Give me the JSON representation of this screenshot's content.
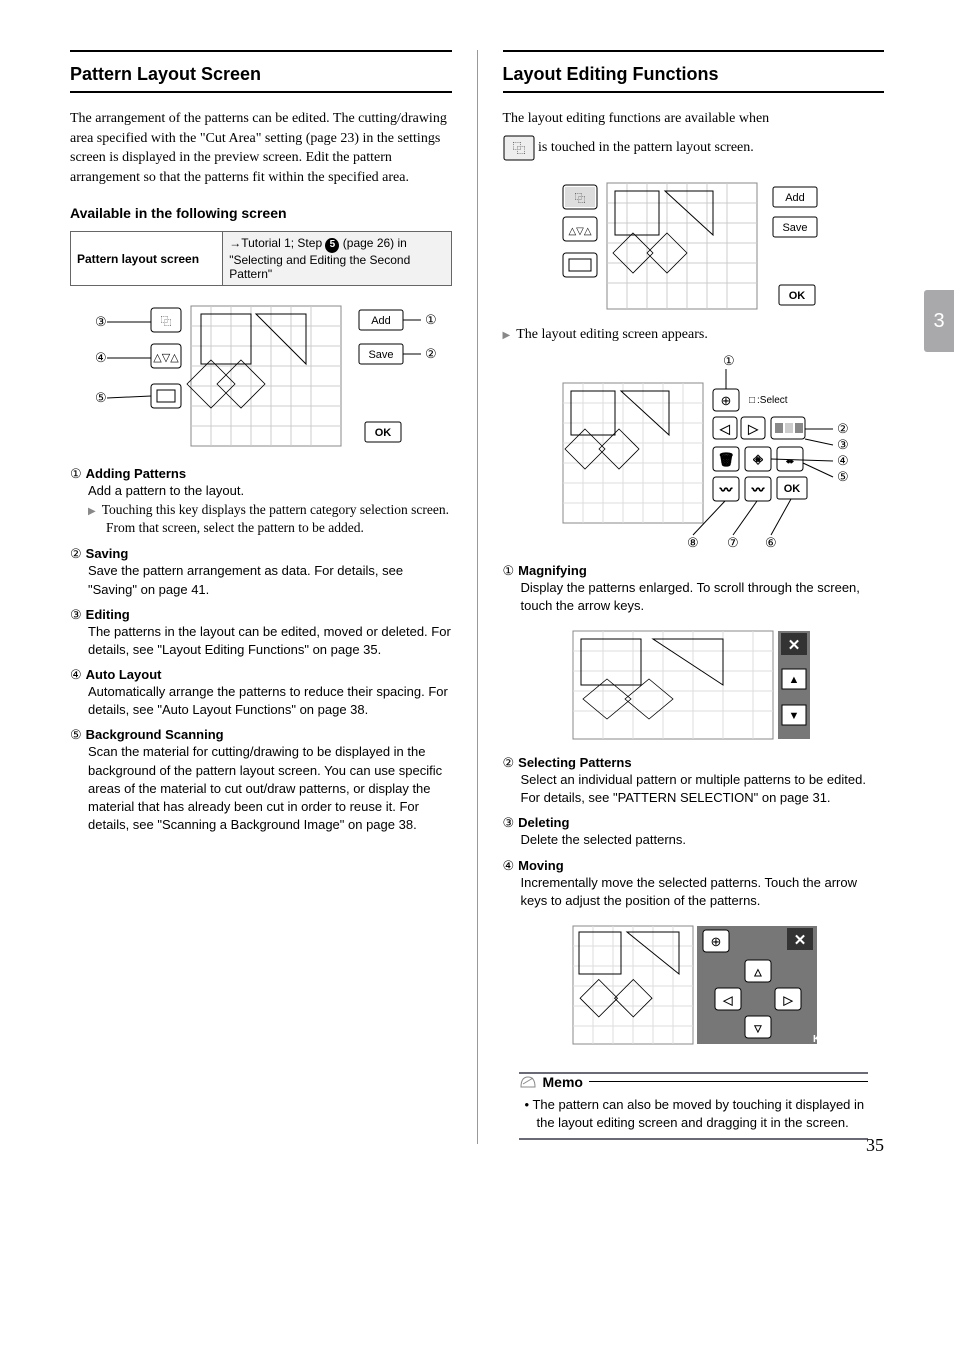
{
  "sideTab": "3",
  "pageNumber": "35",
  "left": {
    "heading": "Pattern Layout Screen",
    "intro": "The arrangement of the patterns can be edited. The cutting/drawing area specified with the \"Cut Area\" setting (page 23) in the settings screen is displayed in the preview screen. Edit the pattern arrangement so that the patterns fit within the specified area.",
    "availHead": "Available in the following screen",
    "tableLeft": "Pattern layout screen",
    "tableRightPrefix": "→Tutorial 1; Step ",
    "tableRightStep": "5",
    "tableRightSuffix": " (page 26) in \"Selecting and Editing the Second Pattern\"",
    "fig1": {
      "add": "Add",
      "save": "Save",
      "ok": "OK"
    },
    "items": [
      {
        "num": "①",
        "title": "Adding Patterns",
        "body": "Add a pattern to the layout.",
        "sub": "Touching this key displays the pattern category selection screen. From that screen, select the pattern to be added."
      },
      {
        "num": "②",
        "title": "Saving",
        "body": "Save the pattern arrangement as data. For details, see \"Saving\" on page 41."
      },
      {
        "num": "③",
        "title": "Editing",
        "body": "The patterns in the layout can be edited, moved or deleted. For details, see \"Layout Editing Functions\" on page 35."
      },
      {
        "num": "④",
        "title": "Auto Layout",
        "body": "Automatically arrange the patterns to reduce their spacing. For details, see \"Auto Layout Functions\" on page 38."
      },
      {
        "num": "⑤",
        "title": "Background Scanning",
        "body": "Scan the material for cutting/drawing to be displayed in the background of the pattern layout screen. You can use specific areas of the material to cut out/draw patterns, or display the material that has already been cut in order to reuse it. For details, see \"Scanning a Background Image\" on page 38."
      }
    ]
  },
  "right": {
    "heading": "Layout Editing Functions",
    "intro1": "The layout editing functions are available when",
    "intro2": " is touched in the pattern layout screen.",
    "fig2": {
      "add": "Add",
      "save": "Save",
      "ok": "OK"
    },
    "result": "The layout editing screen appears.",
    "fig3": {
      "select": ":Select",
      "ok": "OK"
    },
    "items": [
      {
        "num": "①",
        "title": "Magnifying",
        "body": "Display the patterns enlarged. To scroll through the screen, touch the arrow keys."
      },
      {
        "num": "②",
        "title": "Selecting Patterns",
        "body": "Select an individual pattern or multiple patterns to be edited. For details, see \"PATTERN SELECTION\" on page 31."
      },
      {
        "num": "③",
        "title": "Deleting",
        "body": "Delete the selected patterns."
      },
      {
        "num": "④",
        "title": "Moving",
        "body": "Incrementally move the selected patterns. Touch the arrow keys to adjust the position of the patterns."
      }
    ],
    "memo": {
      "label": "Memo",
      "body": "The pattern can also be moved by touching it displayed in the layout editing screen and dragging it in the screen."
    }
  }
}
